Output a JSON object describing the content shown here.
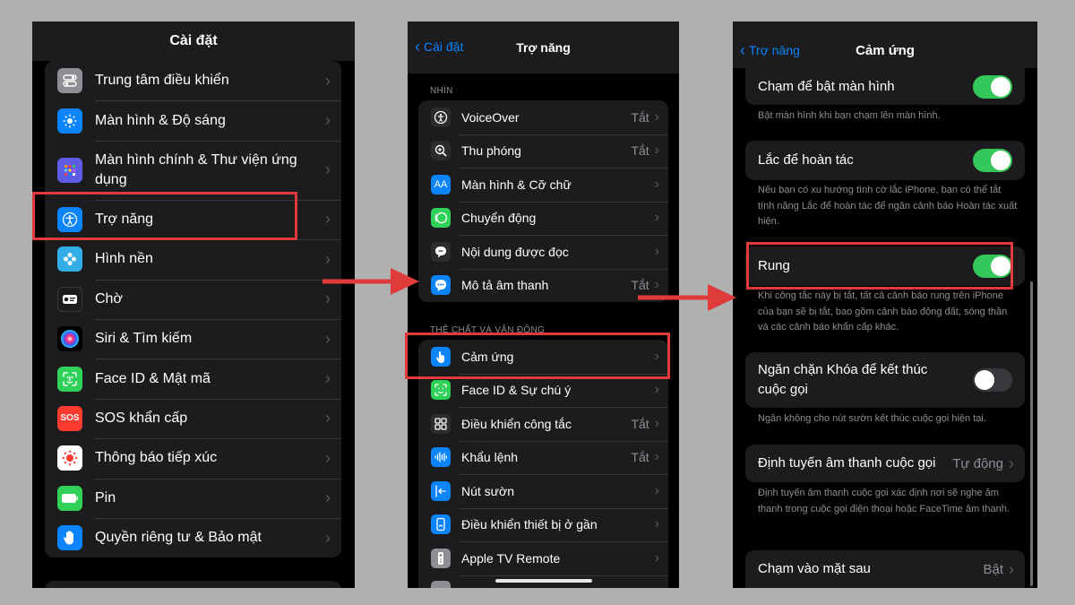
{
  "screen1": {
    "title": "Cài đặt",
    "items": [
      {
        "label": "Trung tâm điều khiển",
        "icon": "control-center-icon",
        "color": "#8e8e93"
      },
      {
        "label": "Màn hình & Độ sáng",
        "icon": "brightness-icon",
        "color": "#0a84ff"
      },
      {
        "label": "Màn hình chính & Thư viện ứng dụng",
        "icon": "home-screen-icon",
        "color": "#5e5ce6"
      },
      {
        "label": "Trợ năng",
        "icon": "accessibility-icon",
        "color": "#0a84ff"
      },
      {
        "label": "Hình nền",
        "icon": "wallpaper-icon",
        "color": "#32ade6"
      },
      {
        "label": "Chờ",
        "icon": "standby-icon",
        "color": "#1c1c1e"
      },
      {
        "label": "Siri & Tìm kiếm",
        "icon": "siri-icon",
        "color": "#2c2c2e"
      },
      {
        "label": "Face ID & Mật mã",
        "icon": "face-id-icon",
        "color": "#30d158"
      },
      {
        "label": "SOS khẩn cấp",
        "icon": "sos-icon",
        "color": "#ff3b30",
        "icon_text": "SOS"
      },
      {
        "label": "Thông báo tiếp xúc",
        "icon": "exposure-notification-icon",
        "color": "#ffffff"
      },
      {
        "label": "Pin",
        "icon": "battery-icon",
        "color": "#30d158"
      },
      {
        "label": "Quyền riêng tư & Bảo mật",
        "icon": "privacy-hand-icon",
        "color": "#0a84ff"
      }
    ]
  },
  "screen2": {
    "back": "Cài đặt",
    "title": "Trợ năng",
    "section_vision": "NHÌN",
    "vision_items": [
      {
        "label": "VoiceOver",
        "value": "Tắt",
        "icon": "voiceover-icon",
        "color": "#2c2c2e"
      },
      {
        "label": "Thu phóng",
        "value": "Tắt",
        "icon": "zoom-icon",
        "color": "#2c2c2e"
      },
      {
        "label": "Màn hình & Cỡ chữ",
        "value": "",
        "icon": "text-size-icon",
        "color": "#0a84ff",
        "icon_text": "AA"
      },
      {
        "label": "Chuyển động",
        "value": "",
        "icon": "motion-icon",
        "color": "#30d158"
      },
      {
        "label": "Nội dung được đọc",
        "value": "",
        "icon": "spoken-content-icon",
        "color": "#2c2c2e"
      },
      {
        "label": "Mô tả âm thanh",
        "value": "Tắt",
        "icon": "audio-description-icon",
        "color": "#0a84ff"
      }
    ],
    "section_physical": "THỂ CHẤT VÀ VẬN ĐỘNG",
    "physical_items": [
      {
        "label": "Cảm ứng",
        "value": "",
        "icon": "touch-icon",
        "color": "#0a84ff"
      },
      {
        "label": "Face ID & Sự chú ý",
        "value": "",
        "icon": "face-id-attention-icon",
        "color": "#30d158"
      },
      {
        "label": "Điều khiển công tắc",
        "value": "Tắt",
        "icon": "switch-control-icon",
        "color": "#2c2c2e"
      },
      {
        "label": "Khẩu lệnh",
        "value": "Tắt",
        "icon": "voice-control-icon",
        "color": "#0a84ff"
      },
      {
        "label": "Nút sườn",
        "value": "",
        "icon": "side-button-icon",
        "color": "#0a84ff"
      },
      {
        "label": "Điều khiển thiết bị ở gần",
        "value": "",
        "icon": "nearby-devices-icon",
        "color": "#0a84ff"
      },
      {
        "label": "Apple TV Remote",
        "value": "",
        "icon": "tv-remote-icon",
        "color": "#8e8e93"
      }
    ]
  },
  "screen3": {
    "back": "Trợ năng",
    "title": "Cảm ứng",
    "tap_to_wake": {
      "label": "Chạm để bật màn hình",
      "on": true,
      "note": "Bật màn hình khi bạn chạm lên màn hình."
    },
    "shake_to_undo": {
      "label": "Lắc để hoàn tác",
      "on": true,
      "note": "Nếu bạn có xu hướng tình cờ lắc iPhone, bạn có thể tắt tính năng Lắc để hoàn tác để ngăn cảnh báo Hoàn tác xuất hiện."
    },
    "vibration": {
      "label": "Rung",
      "on": true,
      "note": "Khi công tắc này bị tắt, tất cả cảnh báo rung trên iPhone của bạn sẽ bị tắt, bao gồm cảnh báo động đất, sóng thần và các cảnh báo khẩn cấp khác."
    },
    "lock_to_end": {
      "label": "Ngăn chặn Khóa để kết thúc cuộc gọi",
      "on": false,
      "note": "Ngăn không cho nút sườn kết thúc cuộc gọi hiện tại."
    },
    "call_routing": {
      "label": "Định tuyến âm thanh cuộc gọi",
      "value": "Tự động",
      "note": "Định tuyến âm thanh cuộc gọi xác định nơi sẽ nghe âm thanh trong cuộc gọi điện thoại hoặc FaceTime âm thanh."
    },
    "back_tap": {
      "label": "Chạm vào mặt sau",
      "value": "Bật"
    }
  },
  "colors": {
    "highlight": "#e03b3b",
    "accent": "#0a84ff",
    "toggle_on": "#34c759"
  }
}
